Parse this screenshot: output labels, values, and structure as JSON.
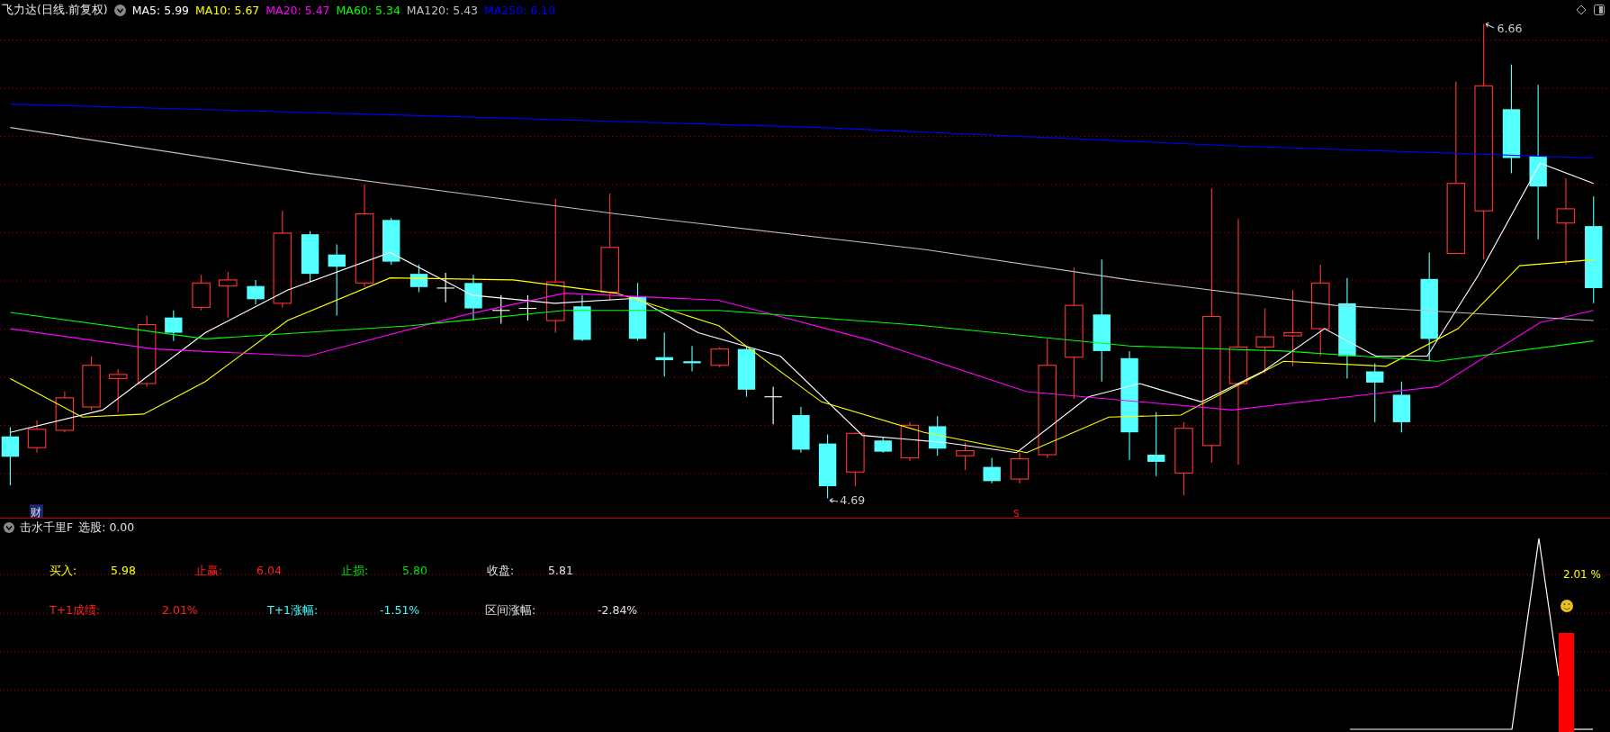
{
  "chart_header": {
    "title": "飞力达(日线.前复权)",
    "ma_legend": [
      {
        "label": "MA5: 5.99",
        "color": "#ffffff"
      },
      {
        "label": "MA10: 5.67",
        "color": "#ffff00"
      },
      {
        "label": "MA20: 5.47",
        "color": "#ff00ff"
      },
      {
        "label": "MA60: 5.34",
        "color": "#00ff00"
      },
      {
        "label": "MA120: 5.43",
        "color": "#c0c0c0"
      },
      {
        "label": "MA250: 6.10",
        "color": "#0000ff"
      }
    ]
  },
  "chart_annotations": {
    "high_label": "6.66",
    "low_label": "4.69",
    "finance_marker": "财",
    "signal_marker": "S"
  },
  "indicator_panel": {
    "name": "击水千里F",
    "selection": "选股: 0.00",
    "rows": [
      {
        "items": [
          {
            "label": "买入:",
            "value": "5.98",
            "color": "#ffff00"
          },
          {
            "label": "止赢:",
            "value": "6.04",
            "color": "#ff2020"
          },
          {
            "label": "止损:",
            "value": "5.80",
            "color": "#00e000"
          },
          {
            "label": "收盘:",
            "value": "5.81",
            "color": "#e0e0e0"
          }
        ]
      },
      {
        "items": [
          {
            "label": "T+1成绩:",
            "value": "2.01%",
            "color": "#ff2020"
          },
          {
            "label": "T+1涨幅:",
            "value": "-1.51%",
            "color": "#40ffff"
          },
          {
            "label": "区间涨幅:",
            "value": "-2.84%",
            "color": "#e0e0e0"
          }
        ]
      }
    ],
    "readout": "2.01 %"
  }
}
